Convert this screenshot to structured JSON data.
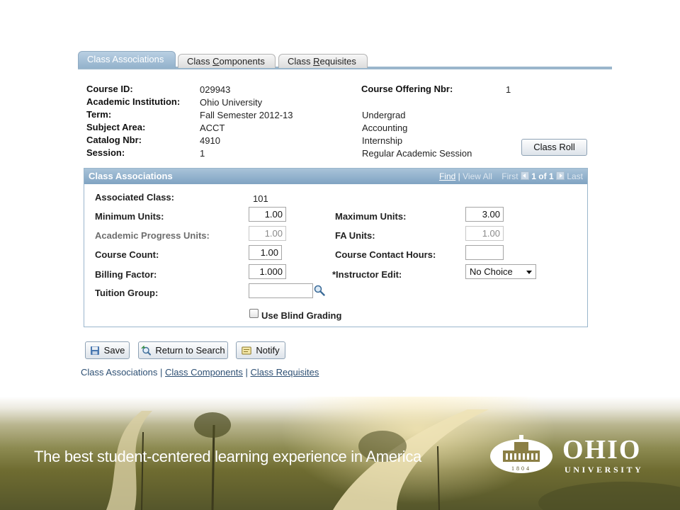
{
  "tabs": [
    {
      "label_pre": "Class Associations",
      "label_key": "",
      "label_post": ""
    },
    {
      "label_pre": "Class ",
      "label_key": "C",
      "label_post": "omponents"
    },
    {
      "label_pre": "Class ",
      "label_key": "R",
      "label_post": "equisites"
    }
  ],
  "header": {
    "course_id_label": "Course ID:",
    "course_id": "029943",
    "institution_label": "Academic Institution:",
    "institution": "Ohio University",
    "term_label": "Term:",
    "term": "Fall Semester 2012-13",
    "term_career": "Undergrad",
    "subject_label": "Subject Area:",
    "subject": "ACCT",
    "subject_desc": "Accounting",
    "catalog_label": "Catalog Nbr:",
    "catalog": "4910",
    "catalog_desc": "Internship",
    "session_label": "Session:",
    "session": "1",
    "session_desc": "Regular Academic Session",
    "offering_label": "Course Offering Nbr:",
    "offering": "1",
    "class_roll_button": "Class Roll"
  },
  "panel": {
    "title": "Class Associations",
    "nav_find": "Find",
    "nav_sep": "|",
    "nav_view_all": "View All",
    "nav_first": "First",
    "nav_count": "1 of 1",
    "nav_last": "Last",
    "associated_class_label": "Associated Class:",
    "associated_class": "101",
    "min_units_label": "Minimum Units:",
    "min_units": "1.00",
    "max_units_label": "Maximum Units:",
    "max_units": "3.00",
    "progress_units_label": "Academic Progress Units:",
    "progress_units": "1.00",
    "fa_units_label": "FA Units:",
    "fa_units": "1.00",
    "course_count_label": "Course Count:",
    "course_count": "1.00",
    "contact_hours_label": "Course Contact Hours:",
    "contact_hours": "",
    "billing_factor_label": "Billing Factor:",
    "billing_factor": "1.000",
    "instructor_edit_label": "*Instructor Edit:",
    "instructor_edit": "No Choice",
    "tuition_group_label": "Tuition Group:",
    "tuition_group": "",
    "blind_grading_label": "Use Blind Grading",
    "blind_grading_checked": false
  },
  "actions": {
    "save": "Save",
    "return_to_search": "Return to Search",
    "notify": "Notify"
  },
  "footer_links": {
    "current": "Class Associations",
    "sep": "|",
    "components": "Class Components",
    "requisites": "Class Requisites"
  },
  "banner": {
    "tagline": "The best student-centered learning experience in America",
    "logo_name": "OHIO",
    "logo_sub": "UNIVERSITY",
    "logo_year": "1804"
  },
  "colors": {
    "tab_active": "#93b2cc",
    "panel_header": "#7fa3c2",
    "link": "#2d4f73"
  }
}
